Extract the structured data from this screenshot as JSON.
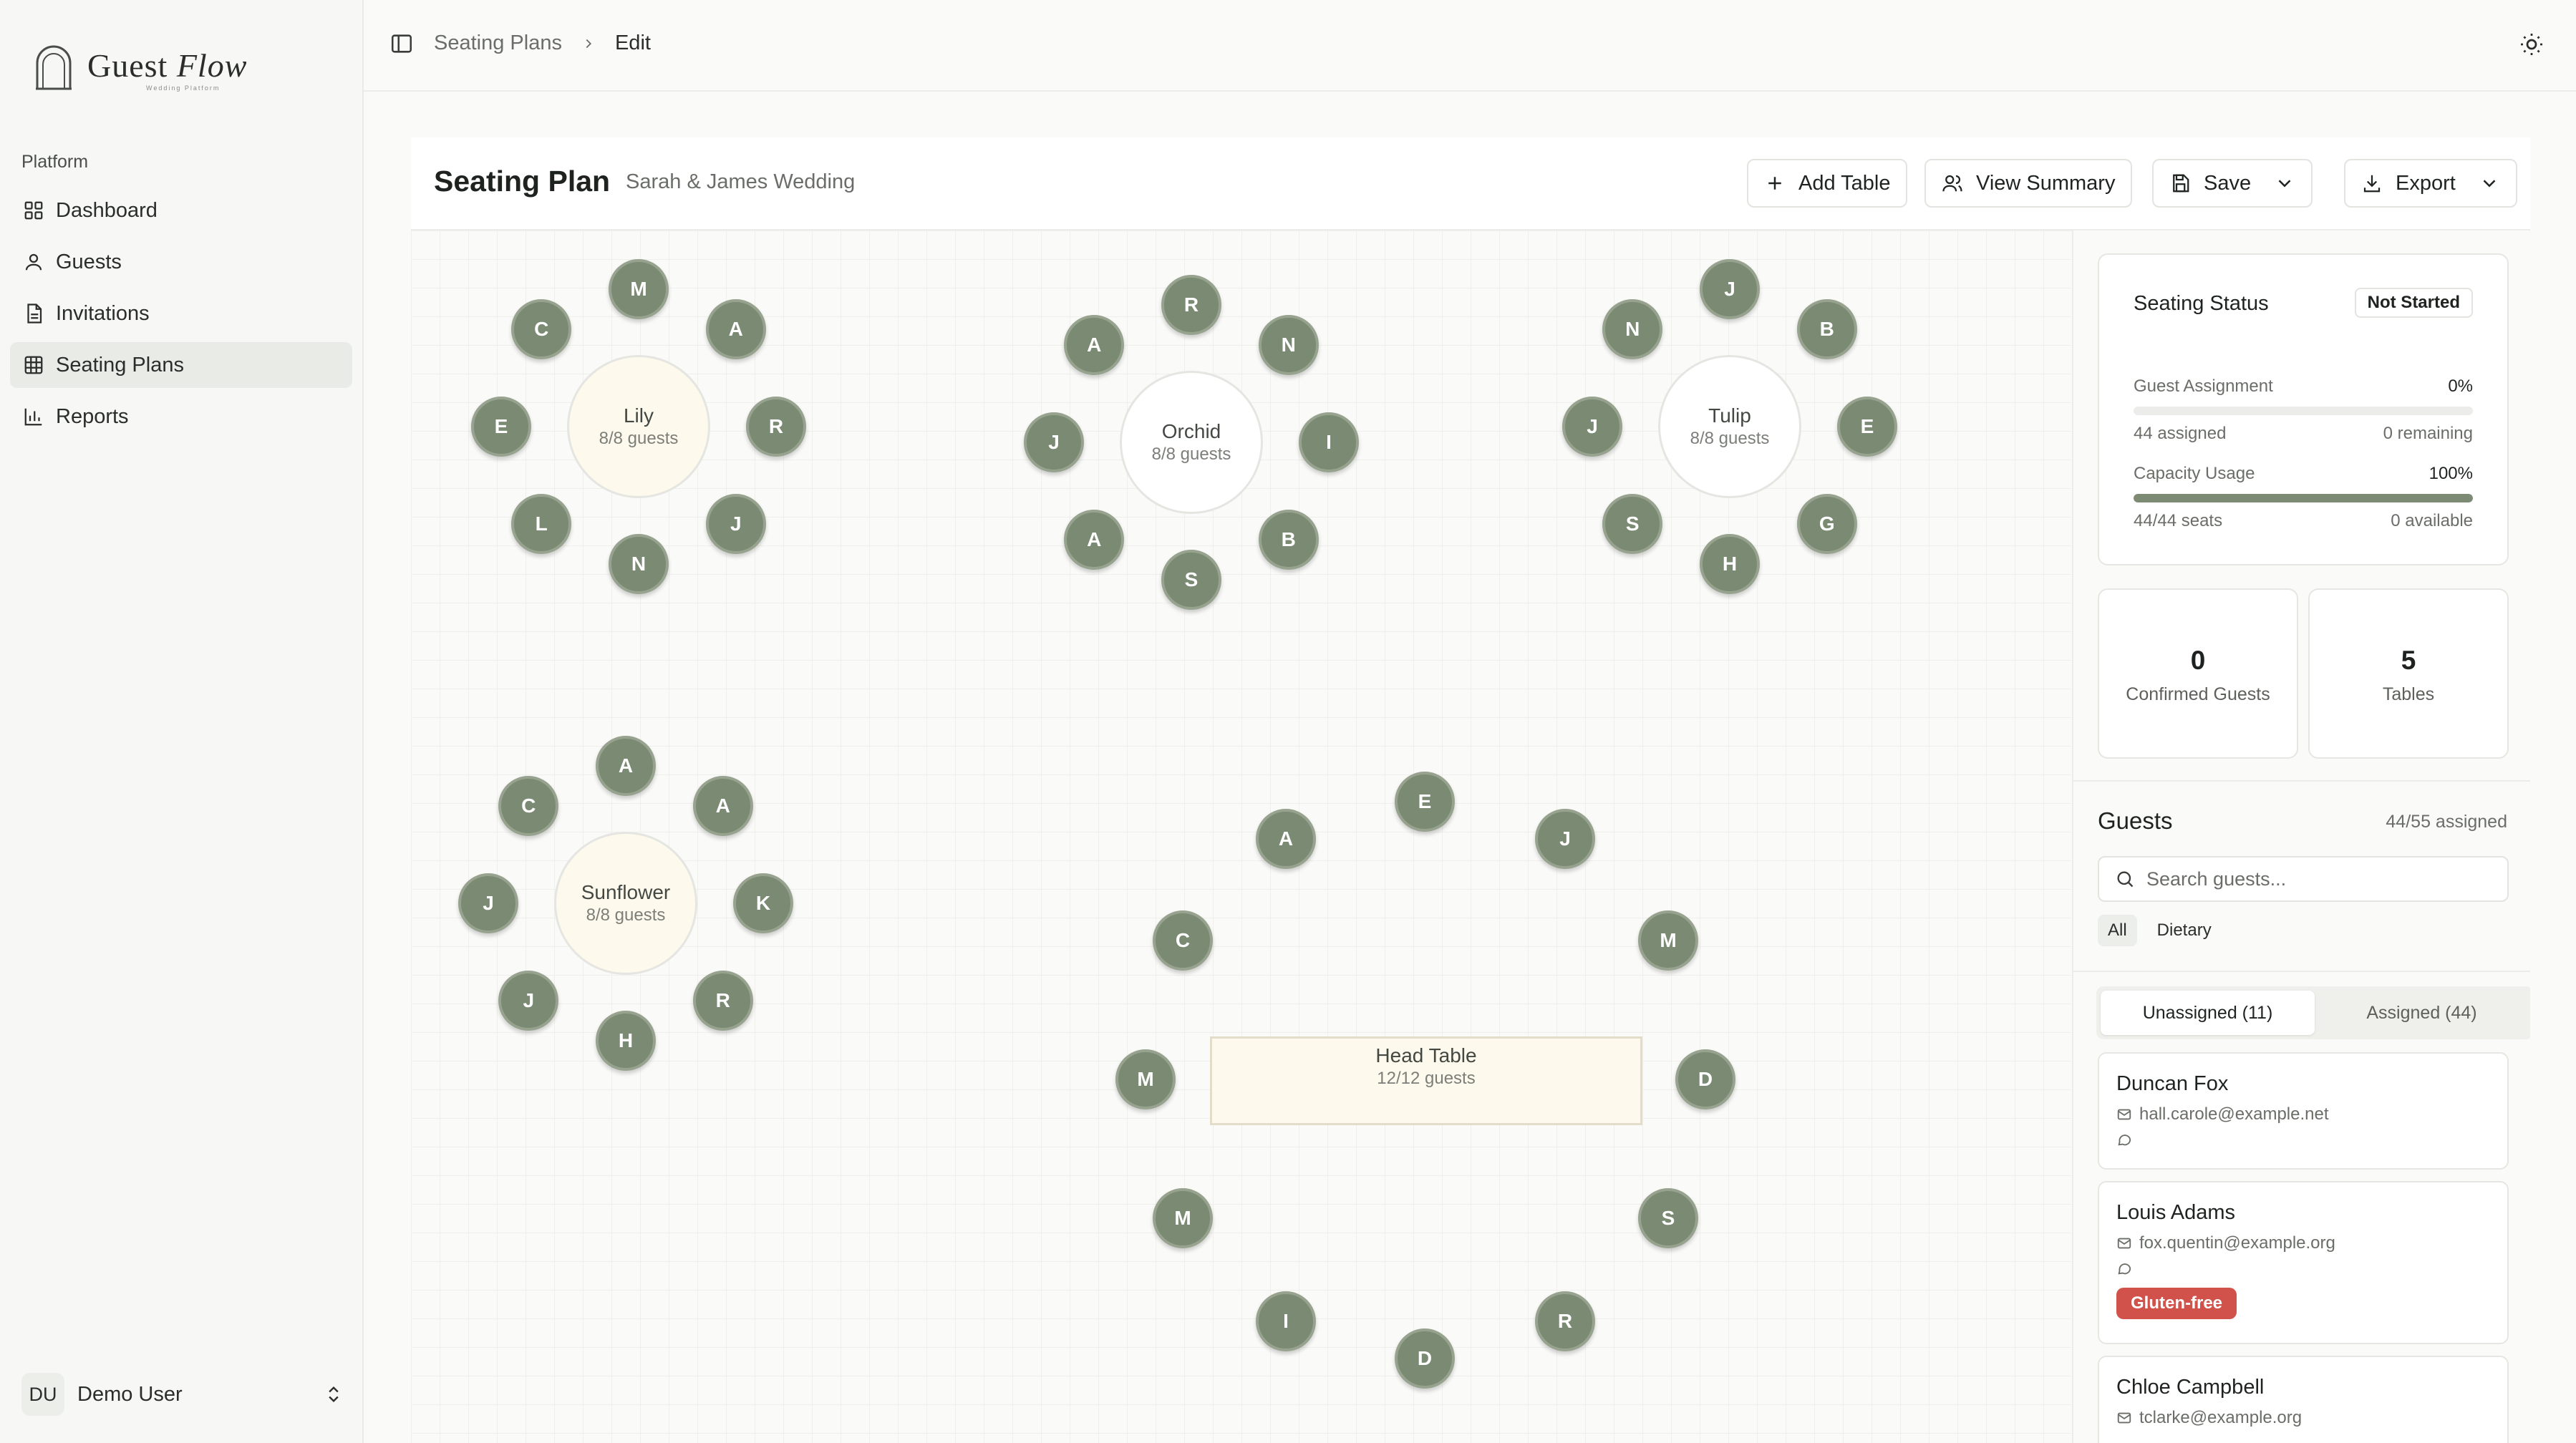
{
  "app": {
    "logo_word1": "Guest",
    "logo_word2": "Flow",
    "logo_sub": "Wedding Platform"
  },
  "sidebar": {
    "group_label": "Platform",
    "items": [
      {
        "label": "Dashboard",
        "icon": "grid-icon"
      },
      {
        "label": "Guests",
        "icon": "user-icon"
      },
      {
        "label": "Invitations",
        "icon": "document-icon"
      },
      {
        "label": "Seating Plans",
        "icon": "table-grid-icon",
        "active": true
      },
      {
        "label": "Reports",
        "icon": "bar-chart-icon"
      }
    ],
    "user": {
      "initials": "DU",
      "name": "Demo User"
    }
  },
  "header": {
    "breadcrumb": [
      "Seating Plans",
      "Edit"
    ]
  },
  "editor": {
    "title": "Seating Plan",
    "subtitle": "Sarah & James Wedding",
    "buttons": {
      "add_table": "Add Table",
      "view_summary": "View Summary",
      "save": "Save",
      "export": "Export"
    }
  },
  "tables": [
    {
      "id": "lily",
      "name": "Lily",
      "count": "8/8 guests",
      "shape": "round",
      "cx": 0,
      "seats": [
        "M",
        "A",
        "R",
        "J",
        "N",
        "L",
        "E",
        "C"
      ],
      "highlight": true
    },
    {
      "id": "orchid",
      "name": "Orchid",
      "count": "8/8 guests",
      "shape": "round",
      "seats": [
        "R",
        "N",
        "I",
        "B",
        "S",
        "A",
        "J",
        "A"
      ],
      "highlight": false
    },
    {
      "id": "tulip",
      "name": "Tulip",
      "count": "8/8 guests",
      "shape": "round",
      "seats": [
        "J",
        "B",
        "E",
        "G",
        "H",
        "S",
        "J",
        "N"
      ],
      "highlight": false
    },
    {
      "id": "sunflower",
      "name": "Sunflower",
      "count": "8/8 guests",
      "shape": "round",
      "seats": [
        "A",
        "A",
        "K",
        "R",
        "H",
        "J",
        "J",
        "C"
      ],
      "highlight": true
    },
    {
      "id": "head",
      "name": "Head Table",
      "count": "12/12 guests",
      "shape": "rect",
      "seats": [
        "E",
        "J",
        "M",
        "D",
        "S",
        "R",
        "D",
        "I",
        "M",
        "M",
        "C",
        "A"
      ],
      "highlight": true
    }
  ],
  "status": {
    "title": "Seating Status",
    "badge": "Not Started",
    "assignment_label": "Guest Assignment",
    "assignment_pct": "0%",
    "assignment_value": 0,
    "assigned_text": "44 assigned",
    "remaining_text": "0 remaining",
    "capacity_label": "Capacity Usage",
    "capacity_pct": "100%",
    "capacity_value": 100,
    "seats_text": "44/44 seats",
    "available_text": "0 available"
  },
  "stats": {
    "confirmed_value": "0",
    "confirmed_label": "Confirmed Guests",
    "tables_value": "5",
    "tables_label": "Tables"
  },
  "guests": {
    "title": "Guests",
    "assigned_count": "44/55 assigned",
    "search_placeholder": "Search guests...",
    "filters": [
      "All",
      "Dietary"
    ],
    "tabs": [
      "Unassigned (11)",
      "Assigned (44)"
    ],
    "list": [
      {
        "name": "Duncan Fox",
        "email": "hall.carole@example.net",
        "diet": ""
      },
      {
        "name": "Louis Adams",
        "email": "fox.quentin@example.org",
        "diet": "Gluten-free"
      },
      {
        "name": "Chloe Campbell",
        "email": "tclarke@example.org",
        "diet": ""
      }
    ]
  },
  "colors": {
    "seat": "#7b8a73",
    "accent_bar": "#7e8b74",
    "diet_badge": "#d0524a",
    "table_highlight": "#fdf9ec"
  }
}
